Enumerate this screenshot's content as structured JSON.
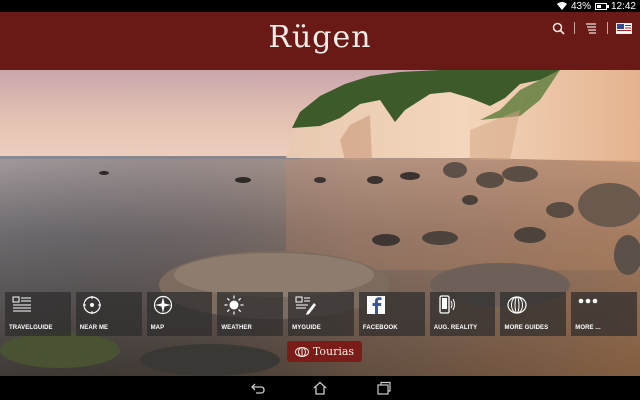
{
  "status": {
    "battery": "43%",
    "time": "12:42"
  },
  "header": {
    "title": "Rügen"
  },
  "header_icons": [
    "search-icon",
    "filter-icon",
    "flag-icon"
  ],
  "menu": [
    {
      "label": "TRAVELGUIDE",
      "icon": "travelguide-icon"
    },
    {
      "label": "NEAR ME",
      "icon": "near-me-icon"
    },
    {
      "label": "MAP",
      "icon": "map-icon"
    },
    {
      "label": "WEATHER",
      "icon": "weather-icon"
    },
    {
      "label": "MYGUIDE",
      "icon": "myguide-icon"
    },
    {
      "label": "FACEBOOK",
      "icon": "facebook-icon"
    },
    {
      "label": "AUG. REALITY",
      "icon": "aug-reality-icon"
    },
    {
      "label": "MORE GUIDES",
      "icon": "more-guides-icon"
    },
    {
      "label": "MORE ...",
      "icon": "more-icon"
    }
  ],
  "brand": {
    "name": "Tourias"
  },
  "nav": [
    "back-icon",
    "home-icon",
    "recent-apps-icon"
  ],
  "colors": {
    "header": "#6a1a16",
    "brand": "#7a1c17",
    "tile": "#2e2c2c"
  }
}
